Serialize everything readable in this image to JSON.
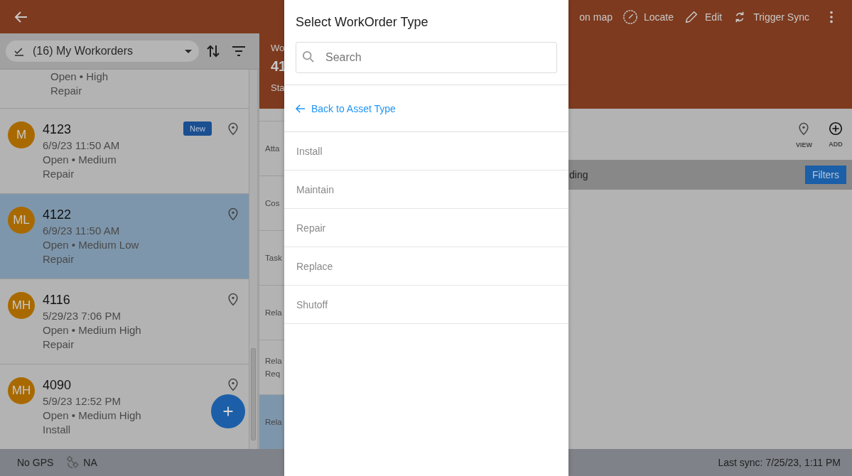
{
  "header": {
    "actions": [
      {
        "label": "on map",
        "kind": "text"
      },
      {
        "label": "Locate",
        "kind": "compass"
      },
      {
        "label": "Edit",
        "kind": "pencil"
      },
      {
        "label": "Trigger Sync",
        "kind": "sync"
      }
    ]
  },
  "workorders": {
    "title": "(16) My Workorders",
    "items": [
      {
        "status": "Open • High",
        "type": "Repair",
        "selected": false
      },
      {
        "initials": "M",
        "number": "4123",
        "date": "6/9/23 11:50 AM",
        "status": "Open • Medium",
        "type": "Repair",
        "badge": "New",
        "selected": false
      },
      {
        "initials": "ML",
        "number": "4122",
        "date": "6/9/23 11:50 AM",
        "status": "Open • Medium Low",
        "type": "Repair",
        "selected": true
      },
      {
        "initials": "MH",
        "number": "4116",
        "date": "5/29/23 7:06 PM",
        "status": "Open • Medium High",
        "type": "Repair",
        "selected": false
      },
      {
        "initials": "MH",
        "number": "4090",
        "date": "5/9/23 12:52 PM",
        "status": "Open • Medium High",
        "type": "Install",
        "selected": false
      }
    ]
  },
  "detail": {
    "label": "Wo",
    "number": "41",
    "status": "Sta",
    "sections": [
      {
        "label": "Atta",
        "selected": false
      },
      {
        "label": "Cos",
        "selected": false
      },
      {
        "label": "Task",
        "selected": false
      },
      {
        "label": "Rela",
        "selected": false
      },
      {
        "label": "Rela Req",
        "selected": false
      },
      {
        "label": "Rela",
        "selected": true
      }
    ],
    "tools": [
      {
        "label": "VIEW",
        "kind": "pin"
      },
      {
        "label": "ADD",
        "kind": "add"
      }
    ],
    "filter_bar": {
      "text": "ding",
      "button": "Filters"
    }
  },
  "dialog": {
    "title": "Select WorkOrder Type",
    "search": {
      "placeholder": "Search"
    },
    "back": "Back to Asset Type",
    "options": [
      "Install",
      "Maintain",
      "Repair",
      "Replace",
      "Shutoff"
    ]
  },
  "status_bar": {
    "gps": "No GPS",
    "satellite": "NA",
    "last_sync": "Last sync: 7/25/23, 1:11 PM"
  }
}
